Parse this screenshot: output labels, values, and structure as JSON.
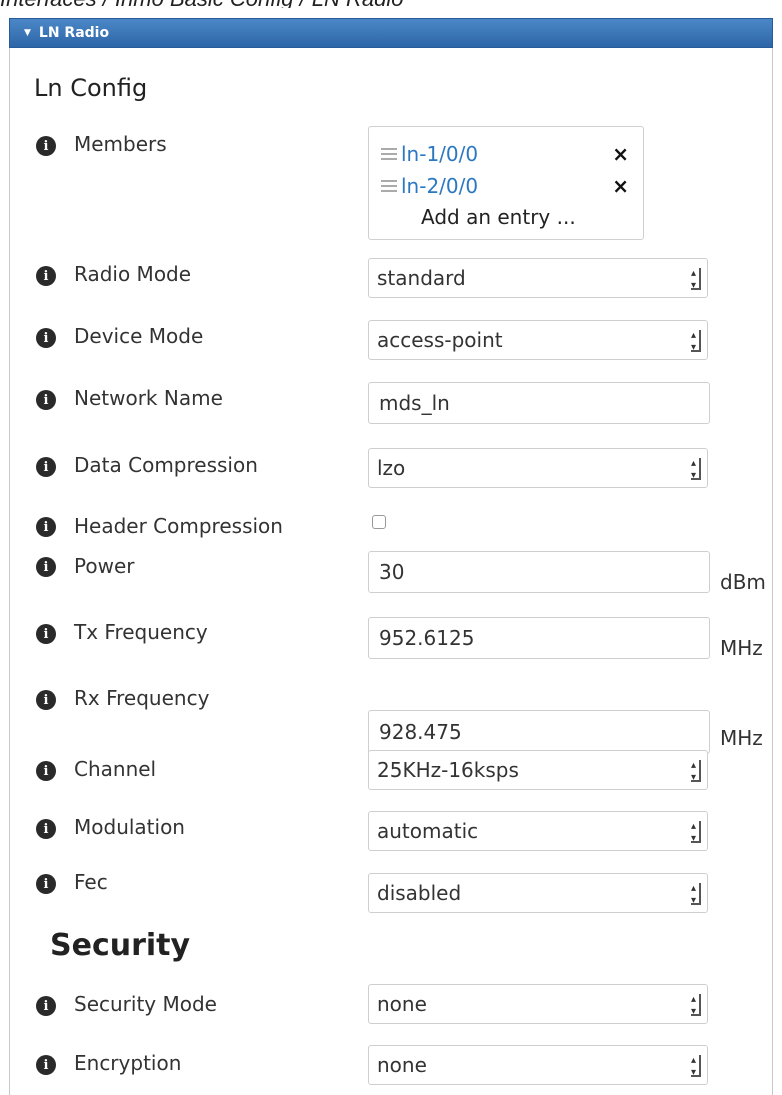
{
  "breadcrumb": "Interfaces / Inmo      Basic Config / LN Radio",
  "panel": {
    "title": "LN Radio"
  },
  "section_ln": "Ln Config",
  "section_security": "Security",
  "members": {
    "label": "Members",
    "entries": [
      "ln-1/0/0",
      "ln-2/0/0"
    ],
    "remove_glyph": "×",
    "add_entry": "Add an entry ..."
  },
  "fields": {
    "radio_mode": {
      "label": "Radio Mode",
      "value": "standard"
    },
    "device_mode": {
      "label": "Device Mode",
      "value": "access-point"
    },
    "network_name": {
      "label": "Network Name",
      "value": "mds_ln"
    },
    "data_compression": {
      "label": "Data Compression",
      "value": "lzo"
    },
    "header_compression": {
      "label": "Header Compression",
      "checked": false
    },
    "power": {
      "label": "Power",
      "value": "30",
      "unit": "dBm"
    },
    "tx_frequency": {
      "label": "Tx Frequency",
      "value": "952.6125",
      "unit": "MHz"
    },
    "rx_frequency": {
      "label": "Rx Frequency",
      "value": "928.475",
      "unit": "MHz"
    },
    "channel": {
      "label": "Channel",
      "value": "25KHz-16ksps"
    },
    "modulation": {
      "label": "Modulation",
      "value": "automatic"
    },
    "fec": {
      "label": "Fec",
      "value": "disabled"
    },
    "security_mode": {
      "label": "Security Mode",
      "value": "none"
    },
    "encryption": {
      "label": "Encryption",
      "value": "none"
    }
  },
  "icons": {
    "info": "info-icon",
    "caret": "caret-down-icon",
    "handle": "drag-handle-icon",
    "select_arrow": "select-arrow-icon"
  },
  "colors": {
    "header_bg": "#3a78bd",
    "link": "#2b78c2"
  }
}
